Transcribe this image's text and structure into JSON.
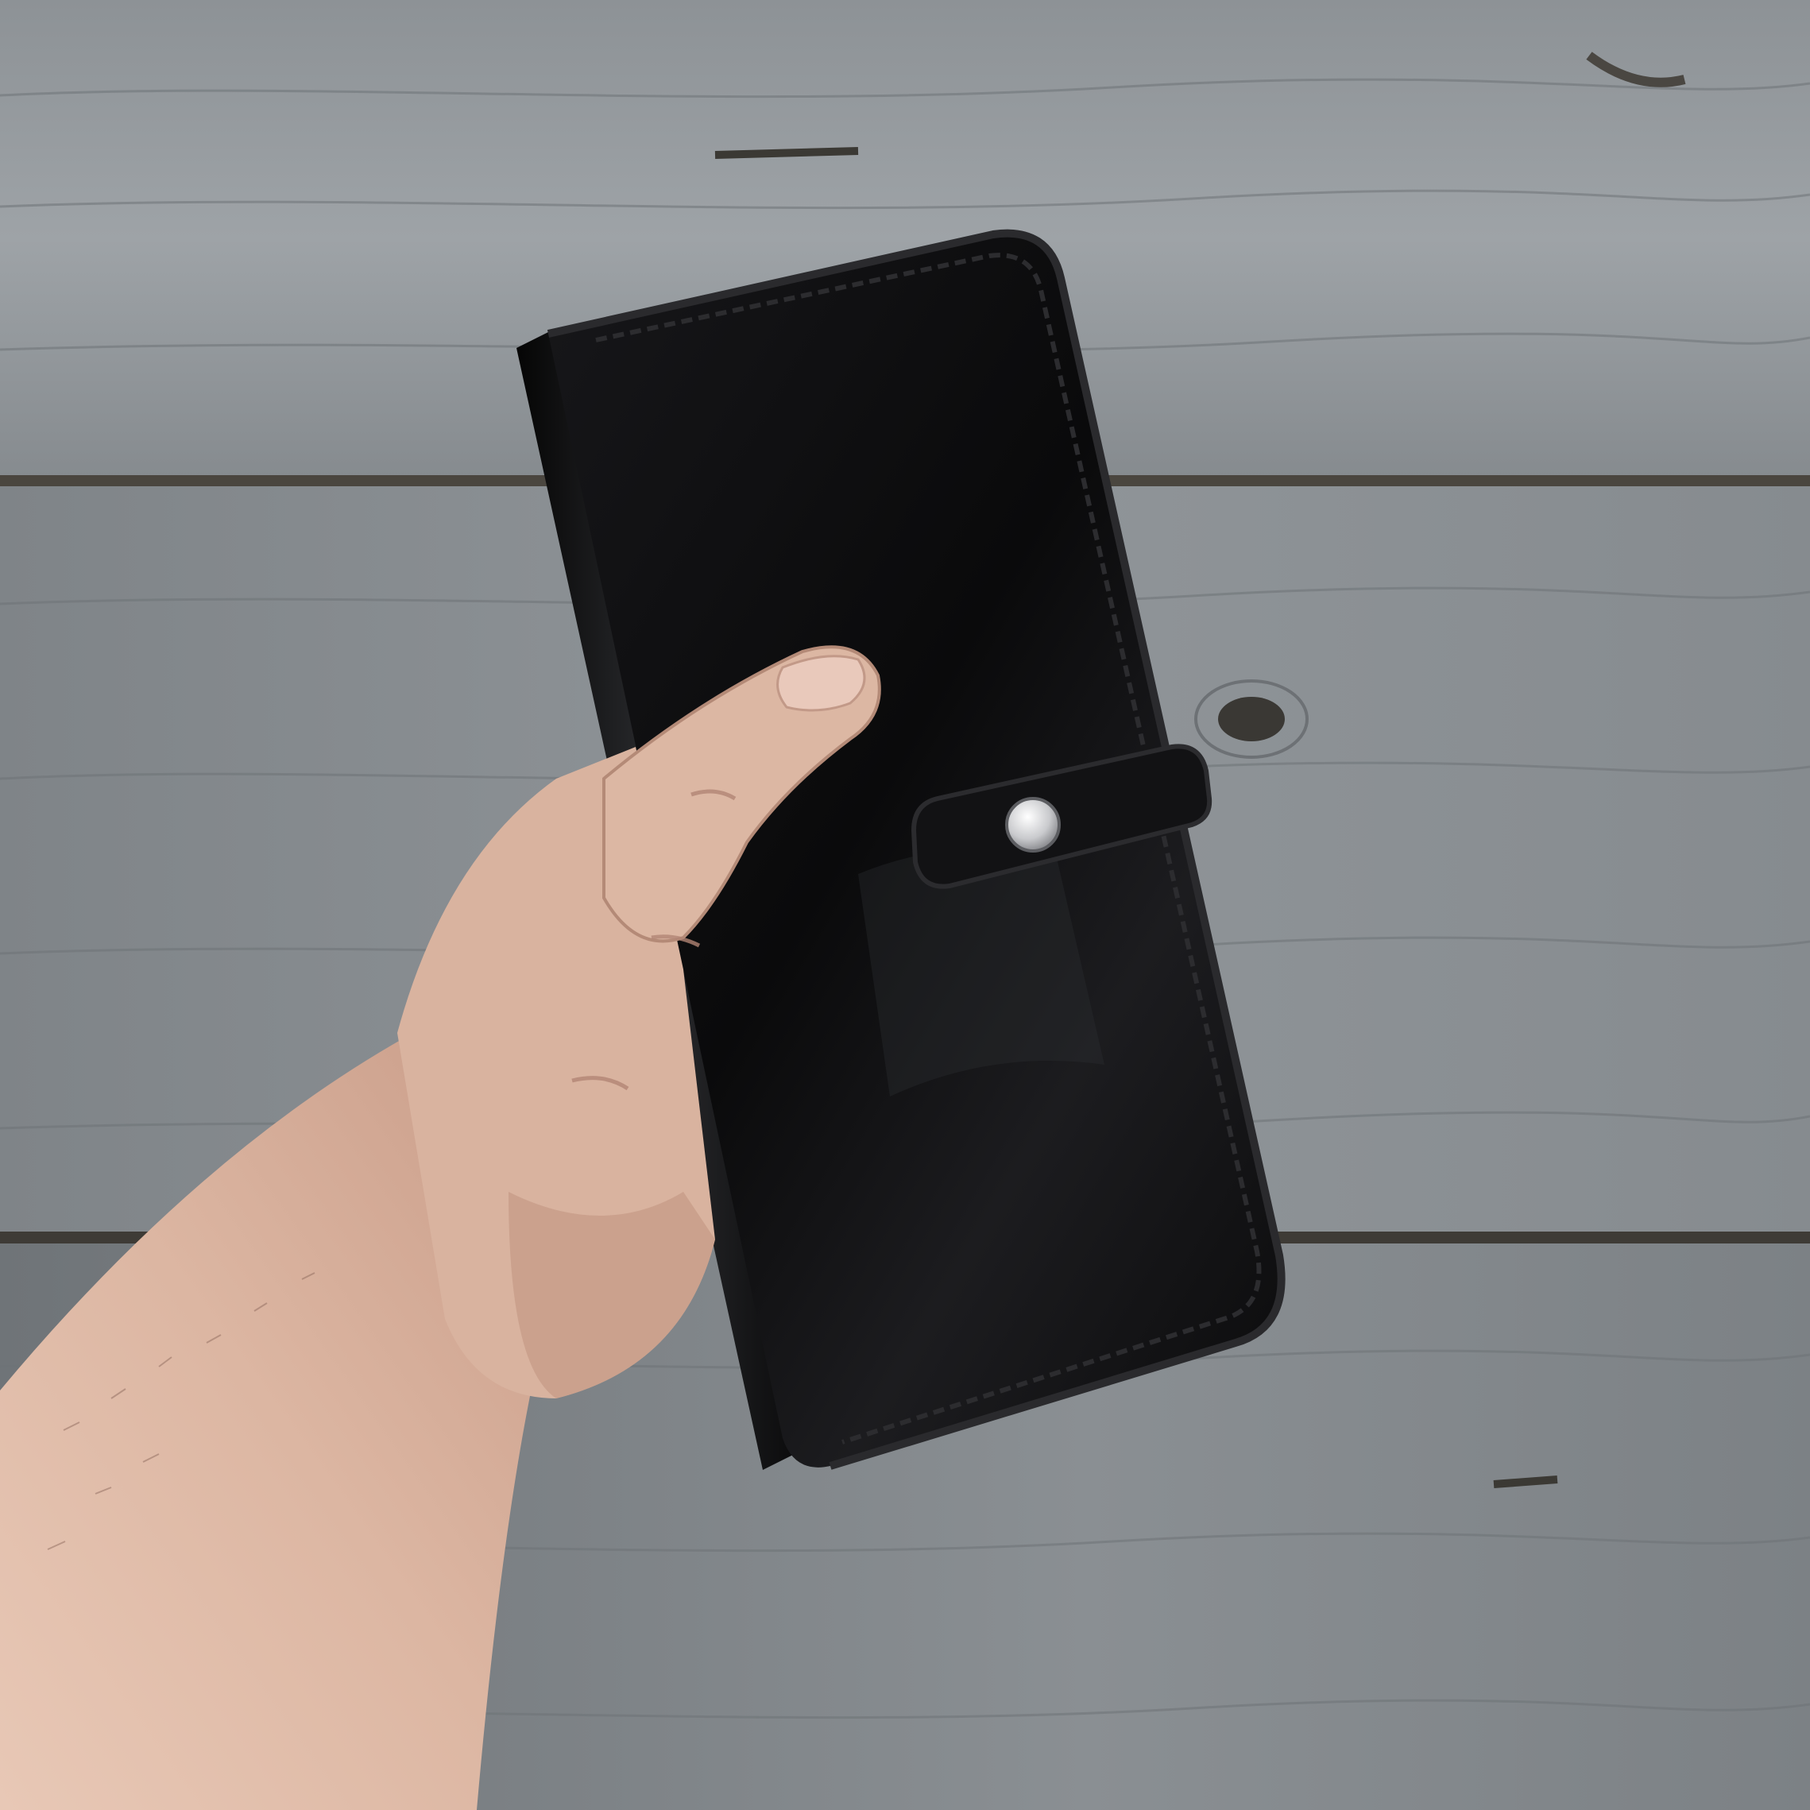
{
  "scene": {
    "subject": "black-leather-long-wallet",
    "background": "weathered-wood-planks",
    "colors": {
      "wood_light": "#9a9fa3",
      "wood_mid": "#858a8e",
      "wood_dark": "#6b7074",
      "plank_gap": "#3e3b36",
      "leather": "#0b0b0c",
      "leather_edge": "#1b1b1d",
      "leather_highlight": "#3a3b3e",
      "stitch": "#232325",
      "skin": "#dcb8a4",
      "skin_shadow": "#b98f7d",
      "snap": "#d8d9dc"
    }
  }
}
